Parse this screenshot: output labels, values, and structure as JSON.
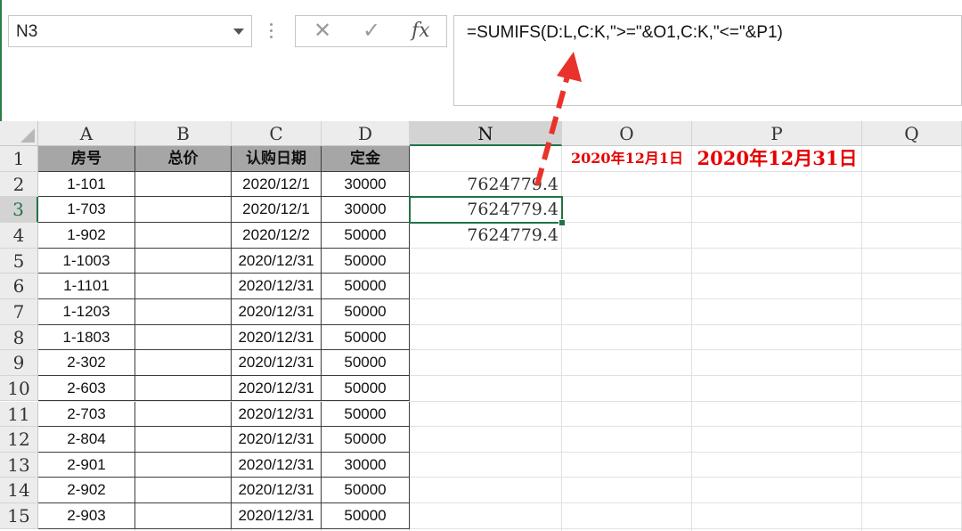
{
  "name_box": {
    "value": "N3"
  },
  "formula_bar": {
    "cancel_icon": "✕",
    "enter_icon": "✓",
    "fx_label": "fx",
    "formula": "=SUMIFS(D:L,C:K,\">=\"&O1,C:K,\"<=\"&P1)"
  },
  "columns": [
    "A",
    "B",
    "C",
    "D",
    "N",
    "O",
    "P",
    "Q"
  ],
  "active_column": "N",
  "active_row": "3",
  "rows": [
    "1",
    "2",
    "3",
    "4",
    "5",
    "6",
    "7",
    "8",
    "9",
    "10",
    "11",
    "12",
    "13",
    "14",
    "15"
  ],
  "table_header": {
    "a": "房号",
    "b": "总价",
    "c": "认购日期",
    "d": "定金"
  },
  "table_rows": [
    {
      "a": "1-101",
      "b": "",
      "c": "2020/12/1",
      "d": "30000"
    },
    {
      "a": "1-703",
      "b": "",
      "c": "2020/12/1",
      "d": "30000"
    },
    {
      "a": "1-902",
      "b": "",
      "c": "2020/12/2",
      "d": "50000"
    },
    {
      "a": "1-1003",
      "b": "",
      "c": "2020/12/31",
      "d": "50000"
    },
    {
      "a": "1-1101",
      "b": "",
      "c": "2020/12/31",
      "d": "50000"
    },
    {
      "a": "1-1203",
      "b": "",
      "c": "2020/12/31",
      "d": "50000"
    },
    {
      "a": "1-1803",
      "b": "",
      "c": "2020/12/31",
      "d": "50000"
    },
    {
      "a": "2-302",
      "b": "",
      "c": "2020/12/31",
      "d": "50000"
    },
    {
      "a": "2-603",
      "b": "",
      "c": "2020/12/31",
      "d": "50000"
    },
    {
      "a": "2-703",
      "b": "",
      "c": "2020/12/31",
      "d": "50000"
    },
    {
      "a": "2-804",
      "b": "",
      "c": "2020/12/31",
      "d": "50000"
    },
    {
      "a": "2-901",
      "b": "",
      "c": "2020/12/31",
      "d": "30000"
    },
    {
      "a": "2-902",
      "b": "",
      "c": "2020/12/31",
      "d": "50000"
    },
    {
      "a": "2-903",
      "b": "",
      "c": "2020/12/31",
      "d": "50000"
    }
  ],
  "o1": "2020年12月1日",
  "p1": "2020年12月31日",
  "n_values": [
    "7624779.4",
    "7624779.4",
    "7624779.4"
  ],
  "annotation": {
    "arrow_color": "#e8322b"
  }
}
